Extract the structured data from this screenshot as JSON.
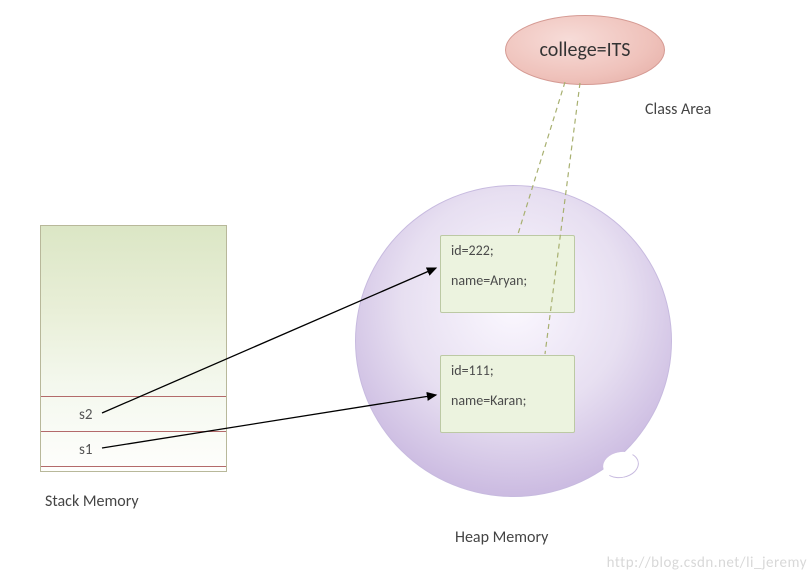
{
  "classArea": {
    "text": "college=ITS",
    "label": "Class Area"
  },
  "stack": {
    "label": "Stack Memory",
    "cells": [
      {
        "name": "s2"
      },
      {
        "name": "s1"
      }
    ]
  },
  "heap": {
    "label": "Heap Memory",
    "objects": [
      {
        "id_line": "id=222;",
        "name_line": "name=Aryan;"
      },
      {
        "id_line": "id=111;",
        "name_line": "name=Karan;"
      }
    ]
  },
  "watermark": "http://blog.csdn.net/li_jeremy"
}
